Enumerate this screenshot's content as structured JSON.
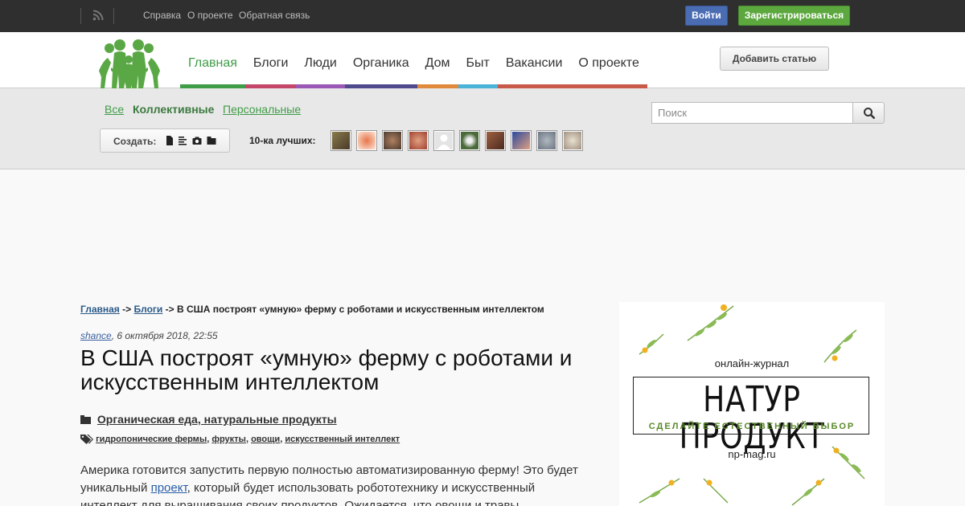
{
  "topbar": {
    "links": [
      "Справка",
      "О проекте",
      "Обратная связь"
    ],
    "login_label": "Войти",
    "register_label": "Зарегистрироваться"
  },
  "header": {
    "nav": [
      {
        "label": "Главная",
        "color": "#3f9c47",
        "active": true
      },
      {
        "label": "Блоги",
        "color": "#c4476a"
      },
      {
        "label": "Люди",
        "color": "#9b59b6"
      },
      {
        "label": "Органика",
        "color": "#4f4a8c"
      },
      {
        "label": "Дом",
        "color": "#e08a3c"
      },
      {
        "label": "Быт",
        "color": "#4ab3d8"
      },
      {
        "label": "Вакансии",
        "color": "#c85a4a"
      },
      {
        "label": "О проекте",
        "color": "#c85a4a"
      }
    ],
    "add_article_label": "Добавить статью"
  },
  "subbar": {
    "filters": [
      "Все",
      "Коллективные",
      "Персональные"
    ],
    "search_placeholder": "Поиск",
    "create_label": "Создать:",
    "top10_label": "10-ка лучших:",
    "avatar_colors": [
      "#6b5a3a",
      "#e8a07a",
      "#8a6a5a",
      "#c98a6a",
      "#d9d9d9",
      "#6a8a4a",
      "#8a4a3a",
      "#3a5a9a",
      "#7a8a9a",
      "#c9c0b0"
    ]
  },
  "article": {
    "breadcrumb": {
      "home": "Главная",
      "sep": "->",
      "blogs": "Блоги",
      "current": "В США построят «умную» ферму с роботами и искусственным интеллектом"
    },
    "author": "shance",
    "date": ", 6 октября 2018, 22:55",
    "title": "В США построят «умную» ферму с роботами и искусственным интеллектом",
    "category": "Органическая еда, натуральные продукты",
    "tags": [
      "гидропонические фермы",
      "фрукты",
      "овощи",
      "искусственный интеллект"
    ],
    "body_before_link": "Америка готовится запустить первую полностью автоматизированную ферму! Это будет уникальный ",
    "body_link": "проект",
    "body_after_link": ", который будет использовать робототехнику и искусственный интеллект для выращивания своих продуктов. Ожидается, что овощи и травы"
  },
  "ad": {
    "subtitle": "онлайн-журнал",
    "brand": "НАТУР ПРОДУКТ",
    "slogan": "СДЕЛАЙТЕ ЕСТЕСТВЕННЫЙ ВЫБОР",
    "url": "np-mag.ru"
  }
}
